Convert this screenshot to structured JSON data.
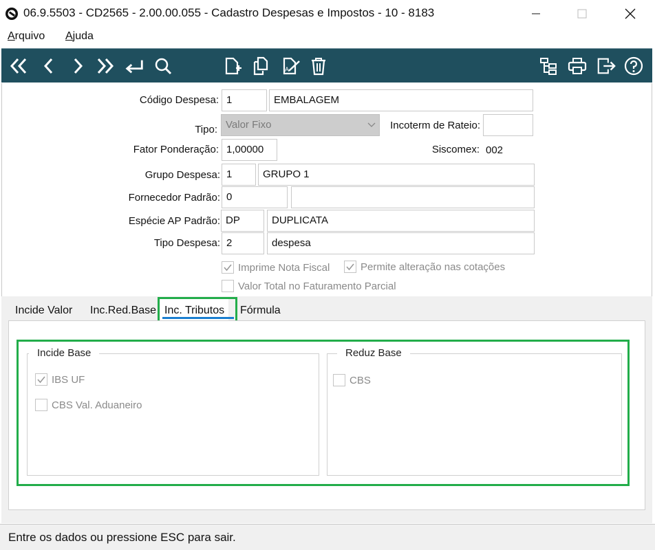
{
  "window": {
    "title": "06.9.5503 - CD2565 - 2.00.00.055 - Cadastro Despesas e Impostos - 10 - 8183"
  },
  "menu": {
    "arquivo_u": "A",
    "arquivo_rest": "rquivo",
    "ajuda_u": "A",
    "ajuda_rest": "juda"
  },
  "toolbar": {
    "icons": [
      "first-icon",
      "previous-icon",
      "next-icon",
      "last-icon",
      "enter-icon",
      "search-icon",
      "new-document-icon",
      "copy-icon",
      "edit-icon",
      "delete-icon",
      "tree-icon",
      "print-icon",
      "exit-icon",
      "help-icon"
    ]
  },
  "form": {
    "codigo_label": "Código Despesa:",
    "codigo_value": "1",
    "codigo_desc": "EMBALAGEM",
    "tipo_label": "Tipo:",
    "tipo_value": "Valor Fixo",
    "incoterm_label": "Incoterm de Rateio:",
    "incoterm_value": "",
    "fator_label": "Fator Ponderação:",
    "fator_value": "1,00000",
    "siscomex_label": "Siscomex:",
    "siscomex_value": "002",
    "grupo_label": "Grupo Despesa:",
    "grupo_value": "1",
    "grupo_desc": "GRUPO 1",
    "fornecedor_label": "Fornecedor Padrão:",
    "fornecedor_value": "0",
    "fornecedor_desc": "",
    "especie_label": "Espécie AP Padrão:",
    "especie_value": "DP",
    "especie_desc": "DUPLICATA",
    "tipodesp_label": "Tipo Despesa:",
    "tipodesp_value": "2",
    "tipodesp_desc": "despesa"
  },
  "checks": {
    "imprime_nf": "Imprime Nota Fiscal",
    "permite_alt": "Permite alteração nas cotações",
    "valor_total": "Valor Total no Faturamento Parcial"
  },
  "tabs": [
    {
      "label": "Incide Valor"
    },
    {
      "label": "Inc.Red.Base"
    },
    {
      "label": "Inc. Tributos"
    },
    {
      "label": "Fórmula"
    }
  ],
  "incide_base": {
    "title": "Incide Base",
    "ibs_uf": "IBS UF",
    "cbs_val_aduaneiro": "CBS Val. Aduaneiro"
  },
  "reduz_base": {
    "title": "Reduz Base",
    "cbs": "CBS"
  },
  "status": "Entre os dados ou pressione ESC para sair.",
  "colors": {
    "toolbar_bg": "#1f4f5e",
    "highlight": "#22ad4a",
    "tab_underline": "#1a7fd0"
  }
}
